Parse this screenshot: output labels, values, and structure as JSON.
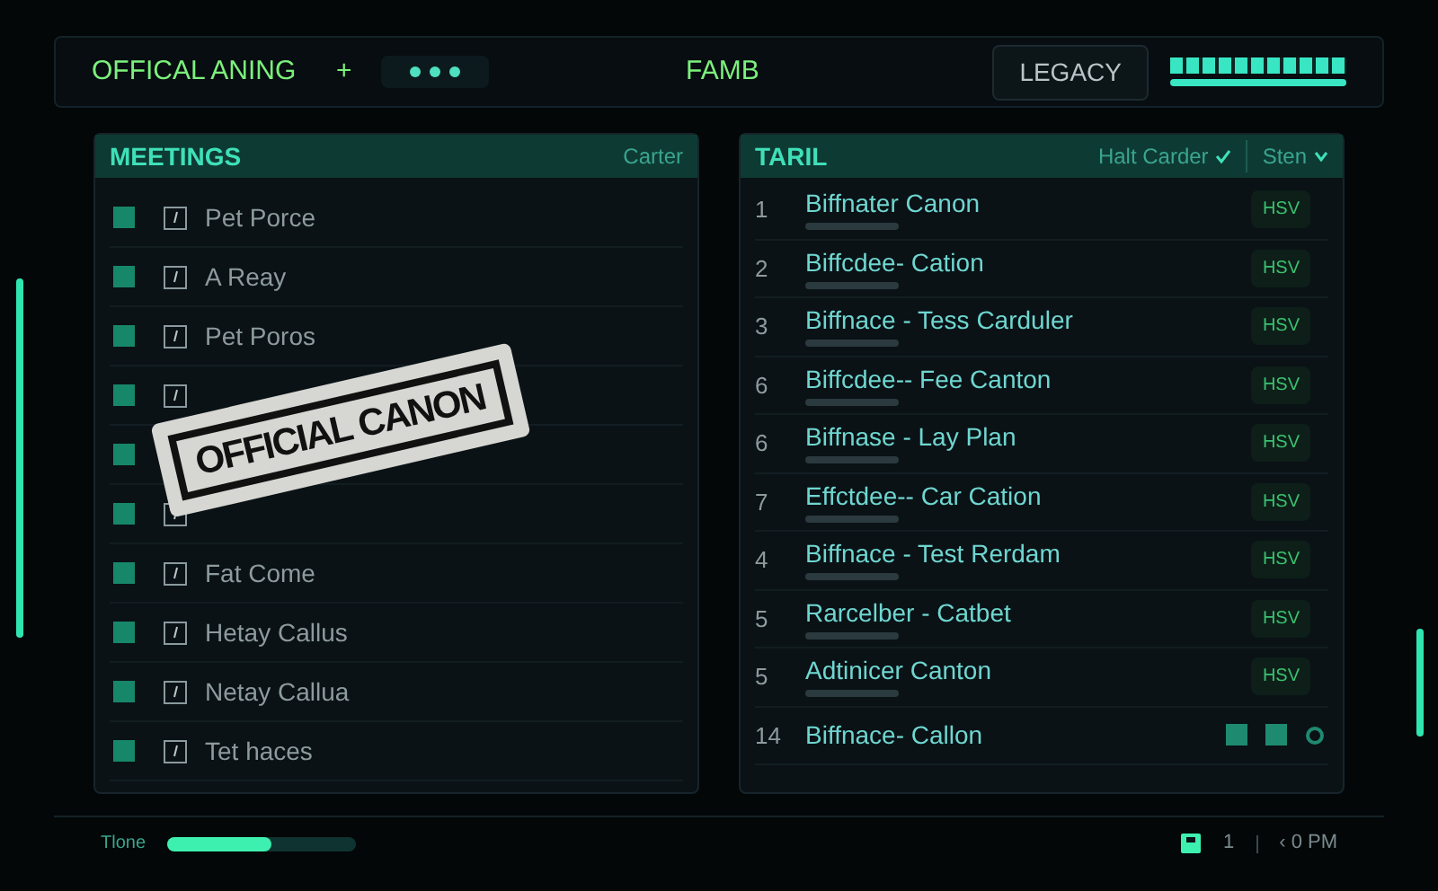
{
  "top_bar": {
    "title": "OFFICAL ANING",
    "add_icon": "+",
    "center_title": "FAMB",
    "legacy_button": "LEGACY",
    "meter": {
      "level": 1
    }
  },
  "meetings": {
    "title": "MEETINGS",
    "action": "Carter",
    "items": [
      {
        "label": "Pet Porce",
        "checked": true
      },
      {
        "label": "A Reay",
        "checked": true
      },
      {
        "label": "Pet Poros",
        "checked": true
      },
      {
        "checked": true,
        "kind": "full"
      },
      {
        "checked": true,
        "kind": "covered"
      },
      {
        "checked": true,
        "kind": "full"
      },
      {
        "label": "Fat Come",
        "checked": true
      },
      {
        "label": "Hetay Callus",
        "checked": true
      },
      {
        "label": "Netay Callua",
        "checked": true
      },
      {
        "label": "Tet haces",
        "checked": true
      }
    ]
  },
  "stamp": {
    "text": "OFFICIAL CANON"
  },
  "table": {
    "title": "TARIL",
    "filter": "Halt Carder",
    "sort": "Sten",
    "rows": [
      {
        "number": "1",
        "title": "Biffnater Canon",
        "kind": "badge",
        "badge": "HSV"
      },
      {
        "number": "2",
        "title": "Biffcdee- Cation",
        "kind": "badge",
        "badge": "HSV"
      },
      {
        "number": "3",
        "title": "Biffnace - Tess Carduler",
        "kind": "badge",
        "badge": "HSV"
      },
      {
        "number": "6",
        "title": "Biffcdee-- Fee Canton",
        "kind": "badge",
        "badge": "HSV"
      },
      {
        "number": "6",
        "title": "Biffnase - Lay Plan",
        "kind": "badge",
        "badge": "HSV"
      },
      {
        "number": "7",
        "title": "Effctdee-- Car Cation",
        "kind": "badge",
        "badge": "HSV"
      },
      {
        "number": "4",
        "title": "Biffnace - Test Rerdam",
        "kind": "badge",
        "badge": "HSV"
      },
      {
        "number": "5",
        "title": "Rarcelber - Catbet",
        "kind": "badge",
        "badge": "HSV"
      },
      {
        "number": "5",
        "title": "Adtinicer Canton",
        "kind": "badge",
        "badge": "HSV"
      },
      {
        "number": "14",
        "title": "Biffnace- Callon",
        "kind": "icons"
      }
    ]
  },
  "status_bar": {
    "label": "Tlone",
    "progress": {
      "level": 0.55
    },
    "page": "1",
    "time": "‹ 0 PM"
  }
}
